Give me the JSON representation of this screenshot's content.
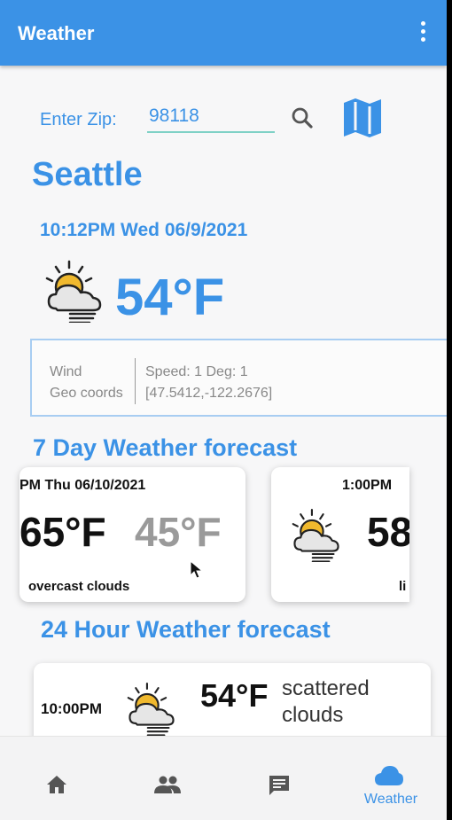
{
  "appbar": {
    "title": "Weather",
    "menu_icon": "more-vert-icon"
  },
  "search": {
    "label": "Enter Zip:",
    "zip_value": "98118",
    "search_icon": "search-icon",
    "map_icon": "map-icon"
  },
  "current": {
    "city": "Seattle",
    "datetime": "10:12PM Wed 06/9/2021",
    "icon": "cloudy-sun-icon",
    "temp": "54°F",
    "wind_label": "Wind",
    "wind_value": "Speed:  1 Deg:  1",
    "geo_label": "Geo coords",
    "geo_value": "[47.5412,-122.2676]"
  },
  "daily": {
    "title": "7 Day Weather forecast",
    "cards": [
      {
        "date": "PM Thu 06/10/2021",
        "hi": "65°F",
        "lo": "45°F",
        "desc": "overcast clouds"
      },
      {
        "date": "1:00PM",
        "hi": "58",
        "desc": "li",
        "icon": "cloudy-sun-icon"
      }
    ]
  },
  "hourly": {
    "title": "24 Hour Weather forecast",
    "item": {
      "time": "10:00PM",
      "temp": "54°F",
      "desc": "scattered clouds",
      "icon": "cloudy-sun-icon"
    }
  },
  "nav": {
    "items": [
      {
        "icon": "home-icon",
        "label": ""
      },
      {
        "icon": "people-icon",
        "label": ""
      },
      {
        "icon": "chat-icon",
        "label": ""
      },
      {
        "icon": "cloud-icon",
        "label": "Weather"
      }
    ]
  },
  "colors": {
    "primary": "#3b92e6",
    "background": "#f7f7f8",
    "divider_teal": "#7fd1c6"
  }
}
